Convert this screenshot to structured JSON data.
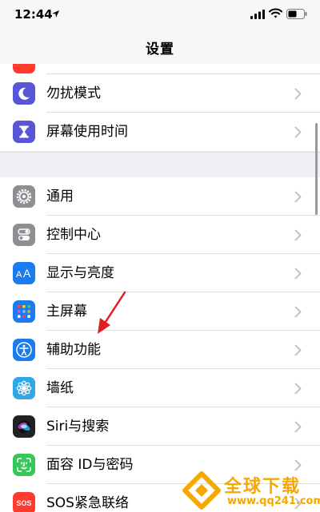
{
  "status_bar": {
    "time": "12:44",
    "icons": [
      "location-arrow-icon",
      "signal-bars-icon",
      "wifi-icon",
      "battery-icon"
    ]
  },
  "nav": {
    "title": "设置"
  },
  "rows": [
    {
      "label": "勿扰模式",
      "icon": "moon-icon",
      "color": "#5856d6"
    },
    {
      "label": "屏幕使用时间",
      "icon": "hourglass-icon",
      "color": "#5856d6"
    },
    {
      "label": "通用",
      "icon": "gear-icon",
      "color": "#8e8e93"
    },
    {
      "label": "控制中心",
      "icon": "toggles-icon",
      "color": "#8e8e93"
    },
    {
      "label": "显示与亮度",
      "icon": "text-size-icon",
      "color": "#1a7cf0"
    },
    {
      "label": "主屏幕",
      "icon": "home-screen-grid-icon",
      "color": "#1a7cf0"
    },
    {
      "label": "辅助功能",
      "icon": "accessibility-icon",
      "color": "#1a7cf0"
    },
    {
      "label": "墙纸",
      "icon": "flower-icon",
      "color": "#32a7e8"
    },
    {
      "label": "Siri与搜索",
      "icon": "siri-icon",
      "color": "#222222"
    },
    {
      "label": "面容 ID与密码",
      "icon": "face-id-icon",
      "color": "#34c759"
    },
    {
      "label": "SOS紧急联络",
      "icon": "sos-icon",
      "color": "#ff3b30",
      "badge": "SOS"
    }
  ],
  "annotation": {
    "icon": "red-arrow-icon",
    "color": "#e02020"
  },
  "watermark": {
    "title": "全球下载",
    "url": "www.qq241.com",
    "color": "#f5a800"
  }
}
